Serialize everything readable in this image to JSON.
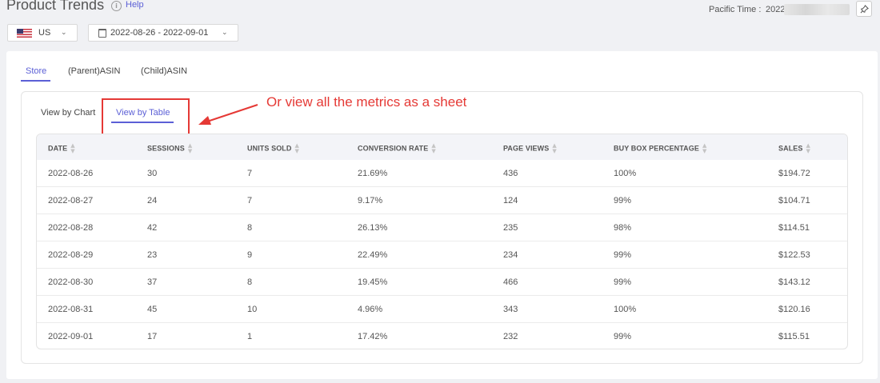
{
  "header": {
    "title": "Product Trends",
    "help_label": "Help",
    "pacific_time_label": "Pacific Time :",
    "pacific_time_value": "2022"
  },
  "filters": {
    "country": "US",
    "date_range": "2022-08-26 - 2022-09-01"
  },
  "tabs": [
    {
      "label": "Store",
      "active": true
    },
    {
      "label": "(Parent)ASIN",
      "active": false
    },
    {
      "label": "(Child)ASIN",
      "active": false
    }
  ],
  "view_tabs": [
    {
      "label": "View by Chart",
      "active": false
    },
    {
      "label": "View by Table",
      "active": true
    }
  ],
  "annotation": "Or view all the metrics as a sheet",
  "table": {
    "columns": [
      "DATE",
      "SESSIONS",
      "UNITS SOLD",
      "CONVERSION RATE",
      "PAGE VIEWS",
      "BUY BOX PERCENTAGE",
      "SALES"
    ],
    "rows": [
      [
        "2022-08-26",
        "30",
        "7",
        "21.69%",
        "436",
        "100%",
        "$194.72"
      ],
      [
        "2022-08-27",
        "24",
        "7",
        "9.17%",
        "124",
        "99%",
        "$104.71"
      ],
      [
        "2022-08-28",
        "42",
        "8",
        "26.13%",
        "235",
        "98%",
        "$114.51"
      ],
      [
        "2022-08-29",
        "23",
        "9",
        "22.49%",
        "234",
        "99%",
        "$122.53"
      ],
      [
        "2022-08-30",
        "37",
        "8",
        "19.45%",
        "466",
        "99%",
        "$143.12"
      ],
      [
        "2022-08-31",
        "45",
        "10",
        "4.96%",
        "343",
        "100%",
        "$120.16"
      ],
      [
        "2022-09-01",
        "17",
        "1",
        "17.42%",
        "232",
        "99%",
        "$115.51"
      ]
    ]
  },
  "colors": {
    "accent": "#5b5fd6",
    "annotation_red": "#e53935",
    "header_bg": "#f3f4f8"
  },
  "icons": [
    "info-icon",
    "pin-icon",
    "us-flag-icon",
    "calendar-icon",
    "chevron-down-icon",
    "sort-icon"
  ]
}
